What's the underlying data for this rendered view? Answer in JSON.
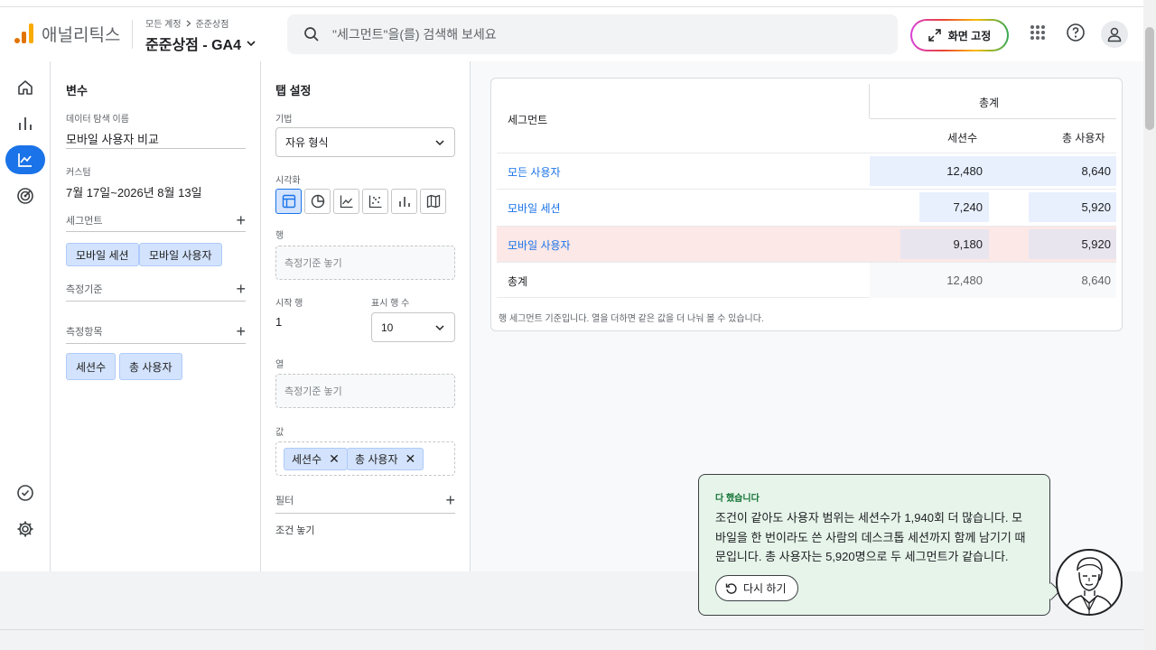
{
  "header": {
    "app_name": "애널리틱스",
    "breadcrumb": [
      "모든 계정",
      "준준상점"
    ],
    "property": "준준상점 - GA4",
    "search_placeholder": "\"세그먼트\"을(를) 검색해 보세요",
    "pin_label": "화면 고정"
  },
  "variables": {
    "title": "변수",
    "exploration_name_label": "데이터 탐색 이름",
    "exploration_name": "모바일 사용자 비교",
    "date_label": "커스텀",
    "date_value": "7월 17일~2026년 8월 13일",
    "segments_label": "세그먼트",
    "segments": [
      "모바일 세션",
      "모바일 사용자"
    ],
    "dimensions_label": "측정기준",
    "metrics_label": "측정항목",
    "metrics": [
      "세션수",
      "총 사용자"
    ]
  },
  "tab_settings": {
    "title": "탭 설정",
    "technique_label": "기법",
    "technique": "자유 형식",
    "viz_label": "시각화",
    "rows_label": "행",
    "rows_placeholder": "측정기준 놓기",
    "start_row_label": "시작 행",
    "start_row": "1",
    "show_rows_label": "표시 행 수",
    "show_rows": "10",
    "columns_label": "열",
    "columns_placeholder": "측정기준 놓기",
    "values_label": "값",
    "values": [
      "세션수",
      "총 사용자"
    ],
    "filters_label": "필터",
    "filters_placeholder": "조건 놓기"
  },
  "table": {
    "segment_header": "세그먼트",
    "group_header": "총계",
    "columns": [
      "세션수",
      "총 사용자"
    ],
    "rows": [
      {
        "name": "모든 사용자",
        "sessions": "12,480",
        "users": "8,640"
      },
      {
        "name": "모바일 세션",
        "sessions": "7,240",
        "users": "5,920"
      },
      {
        "name": "모바일 사용자",
        "sessions": "9,180",
        "users": "5,920"
      }
    ],
    "total_label": "총계",
    "total_sessions": "12,480",
    "total_users": "8,640",
    "note": "행 세그먼트 기준입니다. 열을 더하면 같은 값을 더 나눠 볼 수 있습니다."
  },
  "toast": {
    "title": "다 했습니다",
    "body": "조건이 같아도 사용자 범위는 세션수가 1,940회 더 많습니다. 모바일을 한 번이라도 쓴 사람의 데스크톱 세션까지 함께 남기기 때문입니다. 총 사용자는 5,920명으로 두 세그먼트가 같습니다.",
    "retry_label": "다시 하기"
  },
  "colors": {
    "accent": "#1a73e8",
    "chip": "#d3e3fd",
    "toast_bg": "#e6f4ea",
    "highlight_row": "#fce8e6"
  }
}
